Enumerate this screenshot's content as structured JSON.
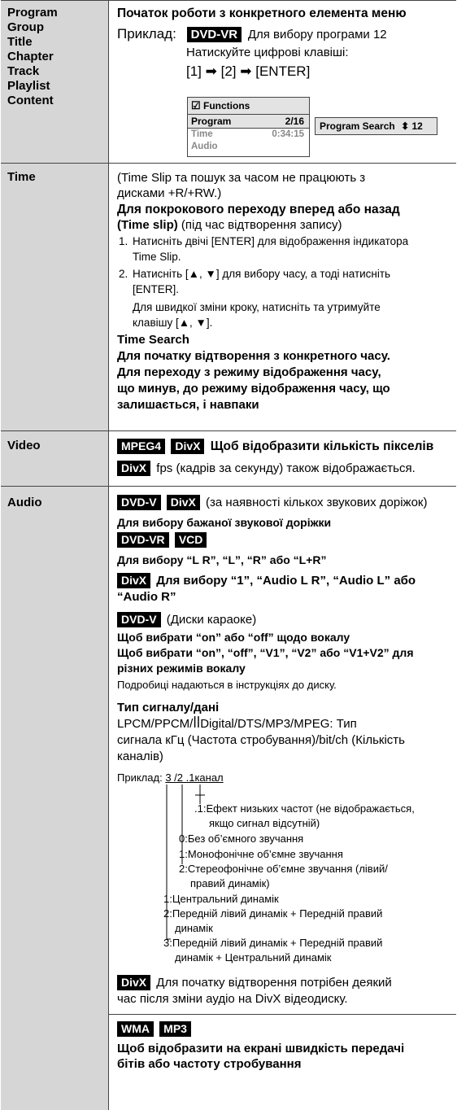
{
  "left_labels": {
    "program_group": [
      "Program",
      "Group",
      "Title",
      "Chapter",
      "Track",
      "Playlist",
      "Content"
    ],
    "time": "Time",
    "video": "Video",
    "audio": "Audio"
  },
  "program": {
    "heading": "Початок роботи з конкретного елемента меню",
    "example_label": "Приклад:",
    "badge": "DVD-VR",
    "example_text": "Для вибору програми 12",
    "press_text": "Натискуйте цифрові клавіші:",
    "keys": [
      "[1]",
      "[2]",
      "[ENTER]"
    ],
    "arrow": "➡",
    "osd": {
      "check_icon": "☑",
      "title": "Functions",
      "program_label": "Program",
      "program_value": "2/16",
      "time_label": "Time",
      "time_value": "0:34:15",
      "audio_label": "Audio",
      "search_label": "Program Search",
      "search_arrows": "⬍",
      "search_value": "12"
    }
  },
  "time": {
    "note_1": "(Time Slip та пошук за часом не працюють з",
    "note_2": "дисками +R/+RW.)",
    "heading_1": "Для покрокового переходу вперед або назад",
    "heading_2_bold": "(Time slip)",
    "heading_2_rest": " (під час відтворення запису)",
    "step1_num": "1.",
    "step1_a": "Натисніть двічі [ENTER] для відображення індикатора",
    "step1_b": "Time Slip.",
    "step2_num": "2.",
    "step2_a": "Натисніть [▲, ▼] для вибору часу, а тоді натисніть",
    "step2_b": "[ENTER].",
    "step2_c": "Для швидкої зміни кроку, натисніть та утримуйте",
    "step2_d": "клавішу [▲, ▼].",
    "search_heading": "Time Search",
    "search_1": "Для початку відтворення з конкретного часу.",
    "search_2": "Для переходу з режиму відображення часу,",
    "search_3": "що минув, до режиму відображення часу, що",
    "search_4": "залишається, і навпаки"
  },
  "video": {
    "badge_1": "MPEG4",
    "badge_2": "DivX",
    "text_1": "Щоб відобразити кількість пікселів",
    "badge_3": "DivX",
    "text_2": "fps (кадрів за секунду) також відображається."
  },
  "audio": {
    "badge_1": "DVD-V",
    "badge_2": "DivX",
    "intro": "(за наявності кількох звукових доріжок)",
    "select_track": "Для вибору бажаної звукової доріжки",
    "badge_3": "DVD-VR",
    "badge_4": "VCD",
    "lr_select": "Для вибору “L R”, “L”, “R” або “L+R”",
    "badge_5": "DivX",
    "divx_select_1": "Для вибору “1”, “Audio L R”, “Audio L” або",
    "divx_select_2": "“Audio R”",
    "badge_6": "DVD-V",
    "karaoke": "(Диски караоке)",
    "vocal_1": "Щоб вибрати “on” або “off” щодо вокалу",
    "vocal_2": "Щоб вибрати “on”, “off”, “V1”, “V2” або “V1+V2” для",
    "vocal_3": "різних режимів вокалу",
    "details": "Подробиці надаються в інструкціях до диску.",
    "signal_heading": "Тип сигналу/дані",
    "signal_1": "LPCM/PPCM/ꟾꟾDigital/DTS/MP3/MPEG: Тип",
    "signal_2": "сигнала кГц (Частота стробування)/bit/ch (Кількість",
    "signal_3": "каналів)",
    "example_label": "Приклад:",
    "example_value": "3 /2 .1канал",
    "diagram": {
      "lfe_1": ".1:Ефект низьких частот (не відображається,",
      "lfe_2": "якщо сигнал відсутній)",
      "s0": "0:Без об’ємного звучання",
      "s1": "1:Монофонічне об’ємне звучання",
      "s2a": "2:Стереофонічне об’ємне звучання (лівий/",
      "s2b": "правий динамік)",
      "f1": "1:Центральний динамік",
      "f2a": "2:Передній лівий динамік + Передній правий",
      "f2b": "динамік",
      "f3a": "3:Передній лівий динамік + Передній правий",
      "f3b": "динамік + Центральний динамік"
    },
    "badge_7": "DivX",
    "divx_note_1": "Для початку відтворення потрібен деякий",
    "divx_note_2": "час після зміни аудіо на DivX відеодиску.",
    "badge_8": "WMA",
    "badge_9": "MP3",
    "bitrate_1": "Щоб відобразити на екрані швидкість передачі",
    "bitrate_2": "бітів або частоту стробування"
  }
}
